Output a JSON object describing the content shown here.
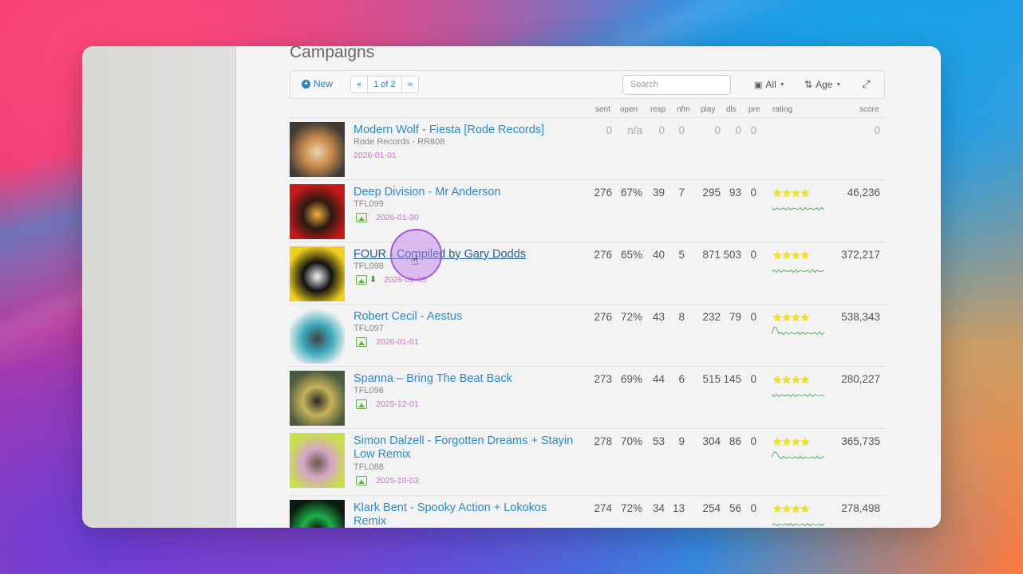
{
  "page": {
    "title": "Campaigns"
  },
  "toolbar": {
    "new_label": "New",
    "pager": {
      "prev": "«",
      "current": "1 of 2",
      "next": "»"
    },
    "search_placeholder": "Search",
    "filter_all": "All",
    "filter_age": "Age"
  },
  "columns": {
    "sent": "sent",
    "open": "open",
    "resp": "resp",
    "nfm": "nfm",
    "play": "play",
    "dls": "dls",
    "pre": "pre",
    "rating": "rating",
    "score": "score"
  },
  "rows": [
    {
      "title": "Modern Wolf - Fiesta [Rode Records]",
      "sub": "Rode Records - RR808",
      "date": "2026-01-01",
      "sent": "0",
      "open": "n/a",
      "resp": "0",
      "nfm": "0",
      "play": "0",
      "dls": "0",
      "pre": "0",
      "score": "0",
      "rating": 0,
      "has_image_icon": false,
      "has_download_icon": false,
      "thumb_colors": [
        "#3f3a36",
        "#c98a4d",
        "#e9d3a9"
      ]
    },
    {
      "title": "Deep Division - Mr Anderson",
      "sub": "TFL099",
      "date": "2026-01-30",
      "sent": "276",
      "open": "67%",
      "resp": "39",
      "nfm": "7",
      "play": "295",
      "dls": "93",
      "pre": "0",
      "score": "46,236",
      "rating": 4,
      "has_image_icon": true,
      "has_download_icon": false,
      "thumb_colors": [
        "#c81a1a",
        "#2a1a12",
        "#f0b040"
      ]
    },
    {
      "title": "FOUR - Compiled by Gary Dodds",
      "sub": "TFL098",
      "date": "2026-02-05",
      "sent": "276",
      "open": "65%",
      "resp": "40",
      "nfm": "5",
      "play": "871",
      "dls": "503",
      "pre": "0",
      "score": "372,217",
      "rating": 4,
      "has_image_icon": true,
      "has_download_icon": true,
      "thumb_colors": [
        "#f0cf1e",
        "#111111",
        "#f5f5f5"
      ]
    },
    {
      "title": "Robert Cecil - Aestus",
      "sub": "TFL097",
      "date": "2026-01-01",
      "sent": "276",
      "open": "72%",
      "resp": "43",
      "nfm": "8",
      "play": "232",
      "dls": "79",
      "pre": "0",
      "score": "538,343",
      "rating": 4,
      "has_image_icon": true,
      "has_download_icon": false,
      "thumb_colors": [
        "#f4f4f4",
        "#3aa7b8",
        "#444444"
      ]
    },
    {
      "title": "Spanna – Bring The Beat Back",
      "sub": "TFL096",
      "date": "2025-12-01",
      "sent": "273",
      "open": "69%",
      "resp": "44",
      "nfm": "6",
      "play": "515",
      "dls": "145",
      "pre": "0",
      "score": "280,227",
      "rating": 4,
      "has_image_icon": true,
      "has_download_icon": false,
      "thumb_colors": [
        "#4a5a3e",
        "#c6b25a",
        "#2c2c2c"
      ]
    },
    {
      "title": "Simon Dalzell - Forgotten Dreams + Stayin Low Remix",
      "sub": "TFL088",
      "date": "2025-10-03",
      "sent": "278",
      "open": "70%",
      "resp": "53",
      "nfm": "9",
      "play": "304",
      "dls": "86",
      "pre": "0",
      "score": "365,735",
      "rating": 4,
      "has_image_icon": true,
      "has_download_icon": false,
      "thumb_colors": [
        "#c7e04a",
        "#d6a6c7",
        "#6a5a4a"
      ]
    },
    {
      "title": "Klark Bent - Spooky Action + Lokokos Remix",
      "sub": "",
      "date": "",
      "sent": "274",
      "open": "72%",
      "resp": "34",
      "nfm": "13",
      "play": "254",
      "dls": "56",
      "pre": "0",
      "score": "278,498",
      "rating": 4,
      "has_image_icon": false,
      "has_download_icon": false,
      "thumb_colors": [
        "#0b1a10",
        "#1fb04a",
        "#0b0b0b"
      ]
    }
  ]
}
